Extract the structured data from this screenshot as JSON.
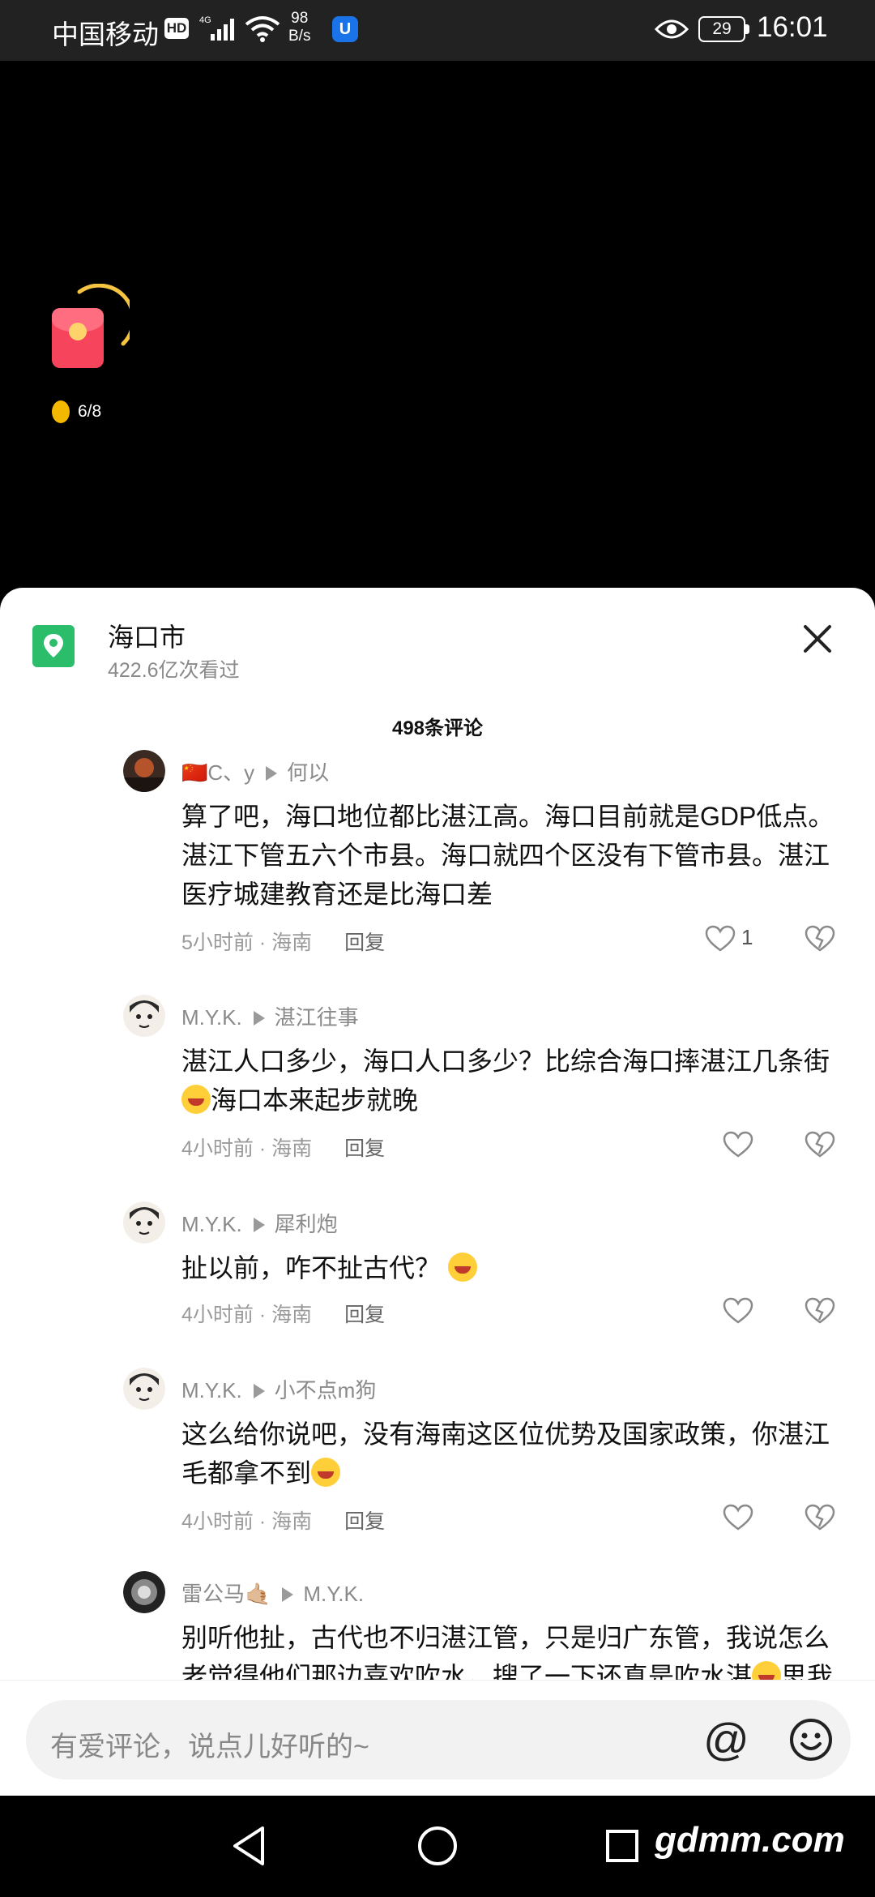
{
  "status_bar": {
    "carrier": "中国移动",
    "hd_badge": "HD",
    "network": "4G",
    "speed_value": "98",
    "speed_unit": "B/s",
    "battery": "29",
    "time": "16:01"
  },
  "reward_widget": {
    "coin_progress": "6/8"
  },
  "location": {
    "title": "海口市",
    "views": "422.6亿次看过"
  },
  "comment_count": "498条评论",
  "comments": [
    {
      "user": "🇨🇳C、y",
      "reply_to": "何以",
      "text": "算了吧，海口地位都比湛江高。海口目前就是GDP低点。湛江下管五六个市县。海口就四个区没有下管市县。湛江医疗城建教育还是比海口差",
      "time": "5小时前",
      "region": "海南",
      "reply_label": "回复",
      "likes": "1"
    },
    {
      "user": "M.Y.K.",
      "reply_to": "湛江往事",
      "text": "湛江人口多少，海口人口多少？比综合海口摔湛江几条街",
      "text_after": "海口本来起步就晚",
      "time": "4小时前",
      "region": "海南",
      "reply_label": "回复"
    },
    {
      "user": "M.Y.K.",
      "reply_to": "犀利炮",
      "text": "扯以前，咋不扯古代？",
      "time": "4小时前",
      "region": "海南",
      "reply_label": "回复"
    },
    {
      "user": "M.Y.K.",
      "reply_to": "小不点m狗",
      "text": "这么给你说吧，没有海南这区位优势及国家政策，你湛江毛都拿不到",
      "time": "4小时前",
      "region": "海南",
      "reply_label": "回复"
    },
    {
      "user": "雷公马🤙🏼",
      "reply_to": "M.Y.K.",
      "text": "别听他扯，古代也不归湛江管，只是归广东管，我说怎么老觉得他们那边喜欢吹水，搜了一下还真是吹水湛",
      "text_after": "思我"
    }
  ],
  "input": {
    "placeholder": "有爱评论，说点儿好听的~",
    "at_symbol": "@"
  },
  "watermark": "gdmm.com"
}
